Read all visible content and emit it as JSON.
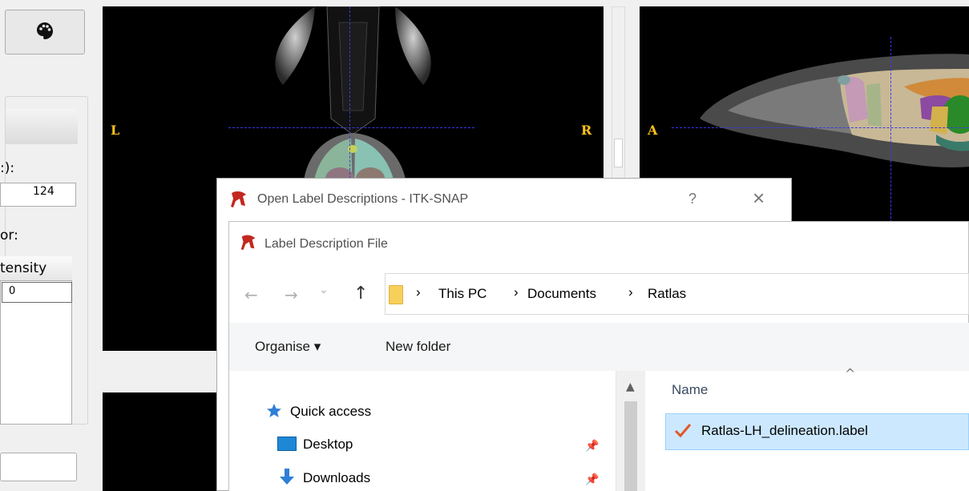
{
  "left_panel": {
    "palette_icon": "palette-icon",
    "label_1": ":):",
    "value_field": "124",
    "label_2": "or:",
    "column_header": "tensity",
    "cell_value": "0"
  },
  "views": {
    "axial": {
      "left_label": "L",
      "right_label": "R"
    },
    "sagittal": {
      "left_label": "A"
    }
  },
  "dialog": {
    "title": "Open Label Descriptions - ITK-SNAP",
    "help_label": "?",
    "close_label": "×",
    "app_icon": "itksnap-icon"
  },
  "file_dialog": {
    "title": "Label Description File",
    "nav": {
      "back": "←",
      "forward": "→",
      "recent": "⌄",
      "up": "↑"
    },
    "breadcrumb": [
      "This PC",
      "Documents",
      "Ratlas"
    ],
    "separator": "›",
    "toolbar": {
      "organise": "Organise ▾",
      "new_folder": "New folder"
    },
    "nav_pane": [
      {
        "label": "Quick access",
        "icon": "star-icon"
      },
      {
        "label": "Desktop",
        "icon": "desktop-icon"
      },
      {
        "label": "Downloads",
        "icon": "download-icon"
      }
    ],
    "column_name": "Name",
    "files": [
      {
        "name": "Ratlas-LH_delineation.label",
        "icon": "checkmark-icon"
      }
    ]
  }
}
